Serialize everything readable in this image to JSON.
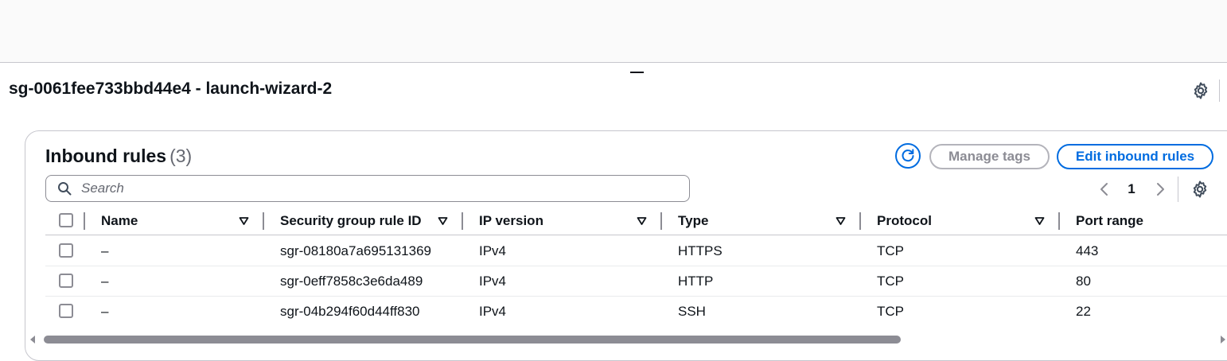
{
  "header": {
    "title": "sg-0061fee733bbd44e4 - launch-wizard-2",
    "settings_icon": "gear-icon"
  },
  "inbound": {
    "title": "Inbound rules",
    "count": "(3)",
    "refresh_icon": "refresh-icon",
    "manage_tags_label": "Manage tags",
    "edit_label": "Edit inbound rules",
    "search_placeholder": "Search",
    "page": "1",
    "columns": [
      "Name",
      "Security group rule ID",
      "IP version",
      "Type",
      "Protocol",
      "Port range"
    ],
    "rows": [
      {
        "name": "–",
        "rule_id": "sgr-08180a7a695131369",
        "ip_version": "IPv4",
        "type": "HTTPS",
        "protocol": "TCP",
        "port_range": "443"
      },
      {
        "name": "–",
        "rule_id": "sgr-0eff7858c3e6da489",
        "ip_version": "IPv4",
        "type": "HTTP",
        "protocol": "TCP",
        "port_range": "80"
      },
      {
        "name": "–",
        "rule_id": "sgr-04b294f60d44ff830",
        "ip_version": "IPv4",
        "type": "SSH",
        "protocol": "TCP",
        "port_range": "22"
      }
    ]
  },
  "colors": {
    "accent": "#006ce0",
    "text": "#0f141a",
    "muted": "#656871",
    "border": "#c6c6cd"
  }
}
